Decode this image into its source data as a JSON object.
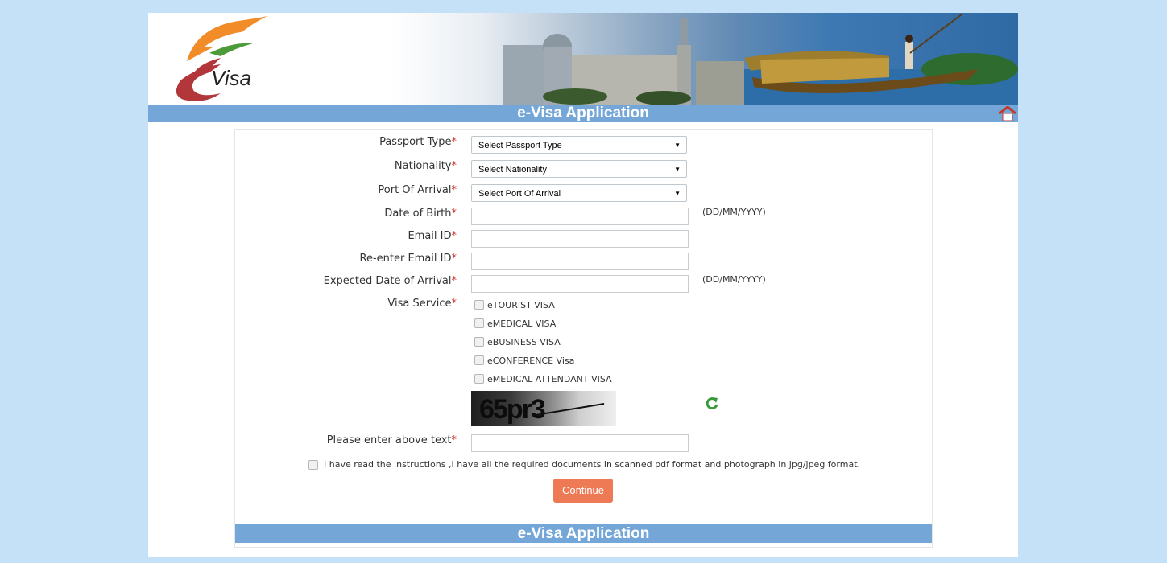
{
  "header": {
    "logo_text": "Visa",
    "title": "e-Visa Application"
  },
  "form": {
    "passport_type": {
      "label": "Passport Type",
      "value": "Select Passport Type"
    },
    "nationality": {
      "label": "Nationality",
      "value": "Select Nationality"
    },
    "port_of_arrival": {
      "label": "Port Of Arrival",
      "value": "Select Port Of Arrival"
    },
    "date_of_birth": {
      "label": "Date of Birth",
      "hint": "(DD/MM/YYYY)"
    },
    "email": {
      "label": "Email ID"
    },
    "reenter_email": {
      "label": "Re-enter Email ID"
    },
    "expected_arrival": {
      "label": "Expected Date of Arrival",
      "hint": "(DD/MM/YYYY)"
    },
    "visa_service": {
      "label": "Visa Service",
      "options": [
        "eTOURIST VISA",
        "eMEDICAL VISA",
        "eBUSINESS VISA",
        "eCONFERENCE Visa",
        "eMEDICAL ATTENDANT VISA"
      ]
    },
    "captcha": {
      "text": "65pr3",
      "input_label": "Please enter above text"
    },
    "required_mark": "*",
    "agreement": "I have read the instructions ,I have all the required documents in scanned pdf format and photograph in jpg/jpeg format.",
    "continue_label": "Continue"
  },
  "footer": {
    "title": "e-Visa Application"
  },
  "colors": {
    "background": "#c5e1f8",
    "title_bar": "#74a7d7",
    "continue_button": "#ee7a55",
    "required": "#c9302c"
  }
}
